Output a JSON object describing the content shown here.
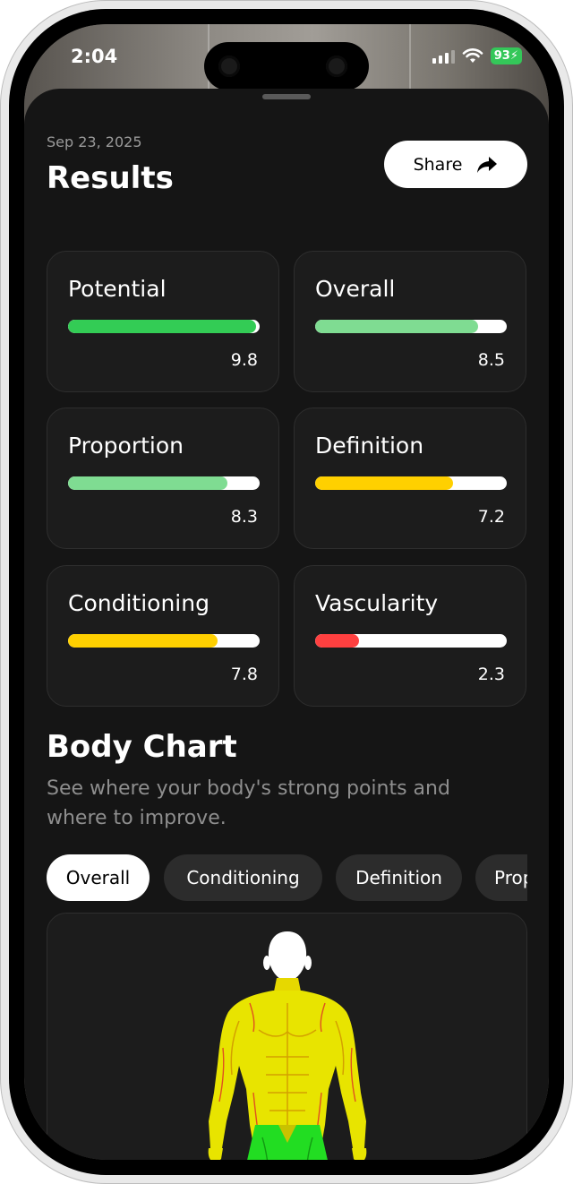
{
  "status_bar": {
    "time": "2:04",
    "battery": "93"
  },
  "header": {
    "date": "Sep 23, 2025",
    "title": "Results",
    "share_label": "Share"
  },
  "metrics": [
    {
      "label": "Potential",
      "score": "9.8",
      "value": 9.8,
      "color": "#33cc55"
    },
    {
      "label": "Overall",
      "score": "8.5",
      "value": 8.5,
      "color": "#7fdc92"
    },
    {
      "label": "Proportion",
      "score": "8.3",
      "value": 8.3,
      "color": "#7fdc92"
    },
    {
      "label": "Definition",
      "score": "7.2",
      "value": 7.2,
      "color": "#ffd000"
    },
    {
      "label": "Conditioning",
      "score": "7.8",
      "value": 7.8,
      "color": "#ffd000"
    },
    {
      "label": "Vascularity",
      "score": "2.3",
      "value": 2.3,
      "color": "#ff4040"
    }
  ],
  "body_chart": {
    "title": "Body Chart",
    "subtitle": "See where your body's strong points and where to improve.",
    "tabs": [
      "Overall",
      "Conditioning",
      "Definition",
      "Proportion"
    ],
    "selected_tab": "Overall"
  },
  "colors": {
    "background": "#151515",
    "card": "#1c1c1c",
    "accent_green": "#33cc55",
    "accent_yellow": "#ffd000",
    "accent_red": "#ff4040"
  },
  "icons": [
    "share-arrow-icon",
    "signal-icon",
    "wifi-icon",
    "battery-icon",
    "body-figure-icon"
  ]
}
